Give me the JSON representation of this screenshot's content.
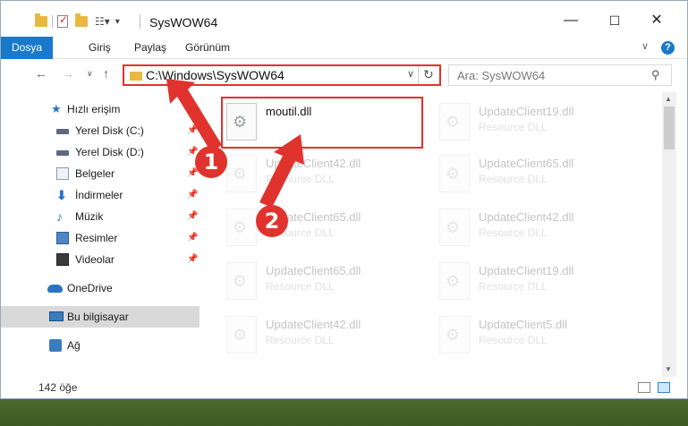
{
  "window": {
    "title": "SysWOW64"
  },
  "ribbon": {
    "tabs": [
      "Dosya",
      "Giriş",
      "Paylaş",
      "Görünüm"
    ],
    "help": "?"
  },
  "address": {
    "path": "C:\\Windows\\SysWOW64",
    "search_placeholder": "Ara: SysWOW64"
  },
  "sidebar": {
    "items": [
      {
        "label": "Hızlı erişim",
        "icon": "star-icon"
      },
      {
        "label": "Yerel Disk (C:)",
        "icon": "drive-icon",
        "pinned": true
      },
      {
        "label": "Yerel Disk (D:)",
        "icon": "drive-icon",
        "pinned": true
      },
      {
        "label": "Belgeler",
        "icon": "documents-icon",
        "pinned": true
      },
      {
        "label": "İndirmeler",
        "icon": "downloads-icon",
        "pinned": true
      },
      {
        "label": "Müzik",
        "icon": "music-icon",
        "pinned": true
      },
      {
        "label": "Resimler",
        "icon": "pictures-icon",
        "pinned": true
      },
      {
        "label": "Videolar",
        "icon": "videos-icon",
        "pinned": true
      },
      {
        "label": "OneDrive",
        "icon": "onedrive-icon"
      },
      {
        "label": "Bu bilgisayar",
        "icon": "computer-icon",
        "selected": true
      },
      {
        "label": "Ağ",
        "icon": "network-icon"
      }
    ]
  },
  "files": [
    {
      "name": "moutil.dll",
      "type": ""
    },
    {
      "name": "UpdateClient19.dll",
      "type": "Resource DLL"
    },
    {
      "name": "UpdateClient42.dll",
      "type": "Resource DLL"
    },
    {
      "name": "UpdateClient65.dll",
      "type": "Resource DLL"
    },
    {
      "name": "UpdateClient65.dll",
      "type": "Resource DLL"
    },
    {
      "name": "UpdateClient42.dll",
      "type": "Resource DLL"
    },
    {
      "name": "UpdateClient65.dll",
      "type": "Resource DLL"
    },
    {
      "name": "UpdateClient19.dll",
      "type": "Resource DLL"
    },
    {
      "name": "UpdateClient42.dll",
      "type": "Resource DLL"
    },
    {
      "name": "UpdateClient5.dll",
      "type": "Resource DLL"
    }
  ],
  "status": {
    "count": "142 öğe"
  },
  "annotations": {
    "badge1": "1",
    "badge2": "2"
  },
  "colors": {
    "accent": "#1979ca",
    "annotation": "#e0332d",
    "selected": "#d9d9d9"
  }
}
